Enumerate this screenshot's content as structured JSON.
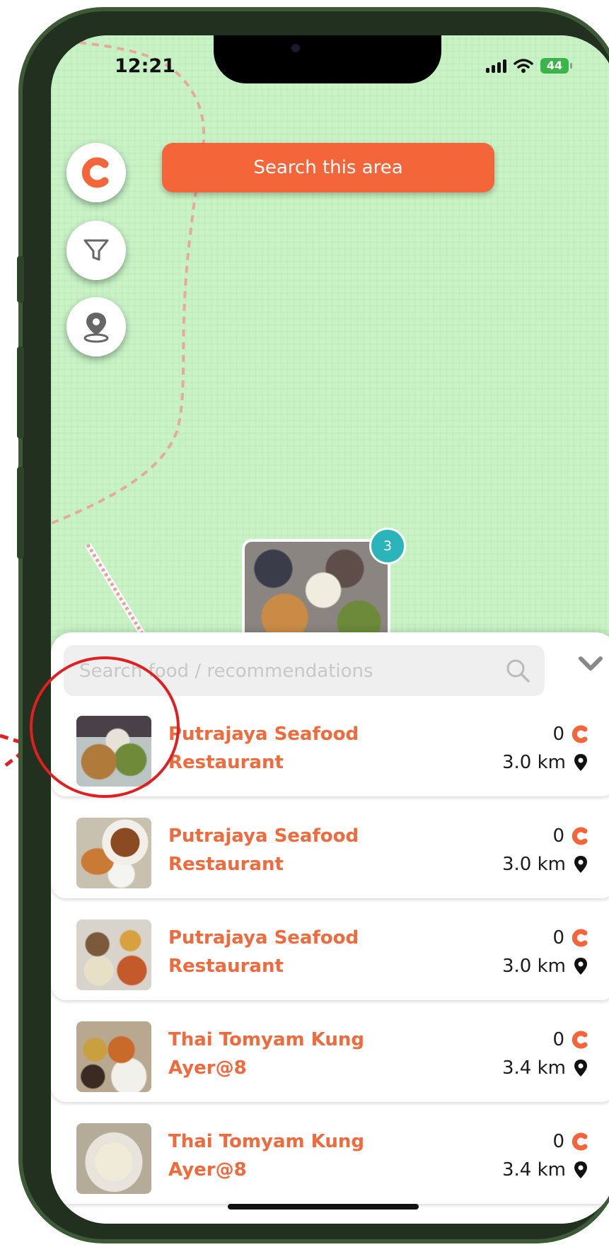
{
  "status_bar": {
    "time": "12:21",
    "battery": "44"
  },
  "map": {
    "search_area_label": "Search this area",
    "fab_buttons": [
      {
        "name": "brand-logo-button",
        "icon": "c-logo-icon"
      },
      {
        "name": "filter-button",
        "icon": "filter-funnel-icon"
      },
      {
        "name": "my-location-button",
        "icon": "location-pin-icon"
      }
    ],
    "cluster_count": "3"
  },
  "search": {
    "placeholder": "Search food / recommendations"
  },
  "colors": {
    "accent": "#f4663a",
    "map_bg": "#c9f3c7",
    "badge": "#2bb5ba"
  },
  "restaurants": [
    {
      "name_line1": "Putrajaya Seafood",
      "name_line2": "Restaurant",
      "points": "0",
      "distance": "3.0 km"
    },
    {
      "name_line1": "Putrajaya Seafood",
      "name_line2": "Restaurant",
      "points": "0",
      "distance": "3.0 km"
    },
    {
      "name_line1": "Putrajaya Seafood",
      "name_line2": "Restaurant",
      "points": "0",
      "distance": "3.0 km"
    },
    {
      "name_line1": "Thai Tomyam Kung",
      "name_line2": "Ayer@8",
      "points": "0",
      "distance": "3.4 km"
    },
    {
      "name_line1": "Thai Tomyam Kung",
      "name_line2": "Ayer@8",
      "points": "0",
      "distance": "3.4 km"
    }
  ]
}
